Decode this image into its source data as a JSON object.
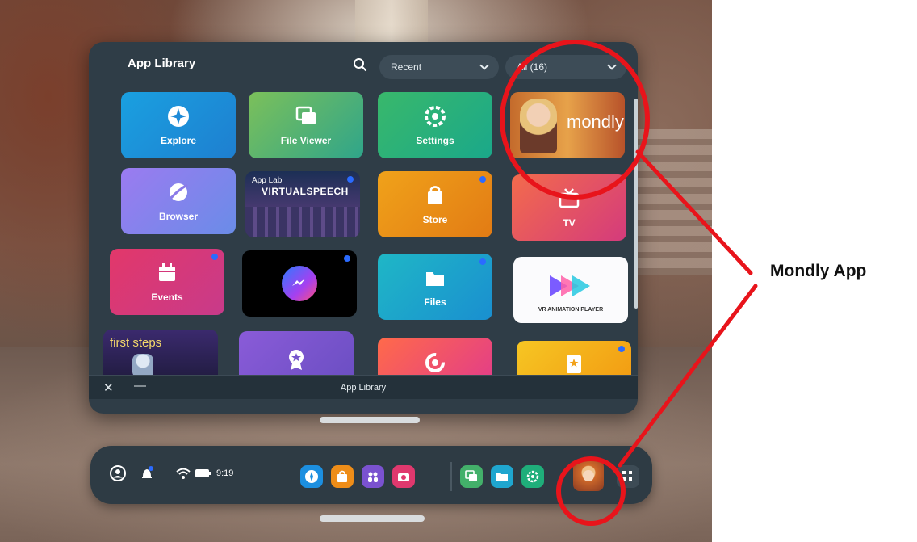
{
  "panel": {
    "title": "App Library",
    "sort_dropdown": "Recent",
    "filter_dropdown": "All (16)",
    "bar_title": "App Library",
    "close_glyph": "✕",
    "minimize_glyph": "—"
  },
  "tiles": [
    {
      "label": "Explore",
      "icon": "compass-icon"
    },
    {
      "label": "File Viewer",
      "icon": "image-stack-icon"
    },
    {
      "label": "Settings",
      "icon": "gear-icon"
    },
    {
      "label": "mondly",
      "icon": "mondly-thumbnail"
    },
    {
      "label": "Browser",
      "icon": "browser-icon"
    },
    {
      "label": "App Lab",
      "sub": "VIRTUALSPEECH",
      "icon": "virtualspeech-thumbnail"
    },
    {
      "label": "Store",
      "icon": "shopping-bag-icon"
    },
    {
      "label": "TV",
      "icon": "tv-icon"
    },
    {
      "label": "Events",
      "icon": "calendar-icon"
    },
    {
      "label": "",
      "icon": "messenger-icon"
    },
    {
      "label": "Files",
      "icon": "folder-icon"
    },
    {
      "label": "VR ANIMATION PLAYER",
      "icon": "vr-animation-logo"
    },
    {
      "label": "first steps",
      "icon": "first-steps-thumbnail"
    },
    {
      "label": "",
      "icon": "award-icon"
    },
    {
      "label": "",
      "icon": "ring-icon"
    },
    {
      "label": "",
      "icon": "book-star-icon"
    }
  ],
  "taskbar": {
    "clock": "9:19",
    "apps": [
      "compass-icon",
      "shopping-bag-icon",
      "people-icon",
      "camera-icon",
      "image-stack-icon",
      "folder-icon",
      "gear-icon",
      "mondly-thumbnail",
      "grid-icon"
    ]
  },
  "annotation": {
    "label": "Mondly App",
    "color": "#e8141b"
  }
}
